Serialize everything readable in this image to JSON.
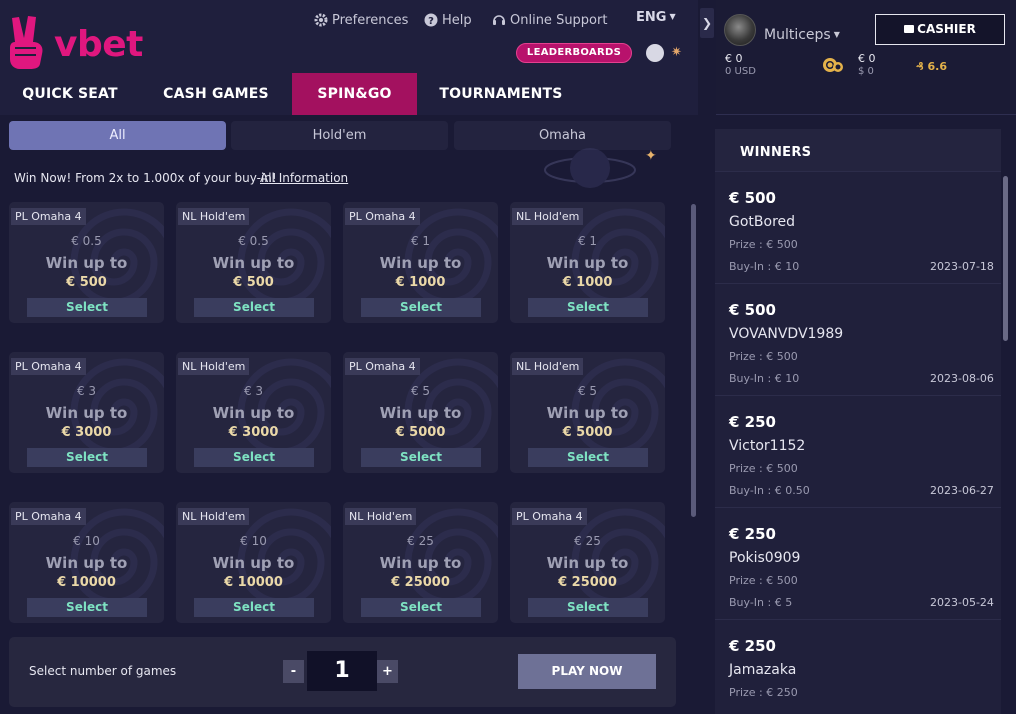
{
  "brand": {
    "name": "vbet",
    "accent": "#e0177f",
    "active_tab_color": "#a3115f"
  },
  "header": {
    "preferences": "Preferences",
    "help": "Help",
    "support": "Online Support",
    "lang": "ENG",
    "leaderboards": "LEADERBOARDS"
  },
  "nav": [
    "QUICK SEAT",
    "CASH GAMES",
    "SPIN&GO",
    "TOURNAMENTS"
  ],
  "nav_active": "SPIN&GO",
  "user": {
    "name": "Multiceps",
    "cashier": "CASHIER",
    "balance_eur": "€ 0",
    "balance_usd": "0 USD",
    "chips_eur": "€ 0",
    "chips_usd": "$ 0",
    "bonus": "6.6"
  },
  "filters": [
    "All",
    "Hold'em",
    "Omaha"
  ],
  "filter_active": "All",
  "promo": {
    "text": "Win Now! From 2x to 1.000x of your buy-in!",
    "link": "All Information"
  },
  "cards": [
    {
      "tag": "PL Omaha 4",
      "buyin": "€ 0.5",
      "win": "Win up to",
      "prize": "€ 500",
      "select": "Select"
    },
    {
      "tag": "NL Hold'em",
      "buyin": "€ 0.5",
      "win": "Win up to",
      "prize": "€ 500",
      "select": "Select"
    },
    {
      "tag": "PL Omaha 4",
      "buyin": "€ 1",
      "win": "Win up to",
      "prize": "€ 1000",
      "select": "Select"
    },
    {
      "tag": "NL Hold'em",
      "buyin": "€ 1",
      "win": "Win up to",
      "prize": "€ 1000",
      "select": "Select"
    },
    {
      "tag": "PL Omaha 4",
      "buyin": "€ 3",
      "win": "Win up to",
      "prize": "€ 3000",
      "select": "Select"
    },
    {
      "tag": "NL Hold'em",
      "buyin": "€ 3",
      "win": "Win up to",
      "prize": "€ 3000",
      "select": "Select"
    },
    {
      "tag": "PL Omaha 4",
      "buyin": "€ 5",
      "win": "Win up to",
      "prize": "€ 5000",
      "select": "Select"
    },
    {
      "tag": "NL Hold'em",
      "buyin": "€ 5",
      "win": "Win up to",
      "prize": "€ 5000",
      "select": "Select"
    },
    {
      "tag": "PL Omaha 4",
      "buyin": "€ 10",
      "win": "Win up to",
      "prize": "€ 10000",
      "select": "Select"
    },
    {
      "tag": "NL Hold'em",
      "buyin": "€ 10",
      "win": "Win up to",
      "prize": "€ 10000",
      "select": "Select"
    },
    {
      "tag": "NL Hold'em",
      "buyin": "€ 25",
      "win": "Win up to",
      "prize": "€ 25000",
      "select": "Select"
    },
    {
      "tag": "PL Omaha 4",
      "buyin": "€ 25",
      "win": "Win up to",
      "prize": "€ 25000",
      "select": "Select"
    }
  ],
  "bottom": {
    "label": "Select number of games",
    "minus": "-",
    "count": "1",
    "plus": "+",
    "play": "PLAY NOW"
  },
  "winners": {
    "title": "WINNERS",
    "items": [
      {
        "amount": "€ 500",
        "name": "GotBored",
        "prize_label": "Prize : ",
        "prize": "€ 500",
        "buyin_label": "Buy-In : ",
        "buyin": "€ 10",
        "date": "2023-07-18"
      },
      {
        "amount": "€ 500",
        "name": "VOVANVDV1989",
        "prize_label": "Prize : ",
        "prize": "€ 500",
        "buyin_label": "Buy-In : ",
        "buyin": "€ 10",
        "date": "2023-08-06"
      },
      {
        "amount": "€ 250",
        "name": "Victor1152",
        "prize_label": "Prize : ",
        "prize": "€ 500",
        "buyin_label": "Buy-In : ",
        "buyin": "€ 0.50",
        "date": "2023-06-27"
      },
      {
        "amount": "€ 250",
        "name": "Pokis0909",
        "prize_label": "Prize : ",
        "prize": "€ 500",
        "buyin_label": "Buy-In : ",
        "buyin": "€ 5",
        "date": "2023-05-24"
      },
      {
        "amount": "€ 250",
        "name": "Jamazaka",
        "prize_label": "Prize : ",
        "prize": "€ 250",
        "buyin_label": "",
        "buyin": "",
        "date": ""
      }
    ]
  }
}
